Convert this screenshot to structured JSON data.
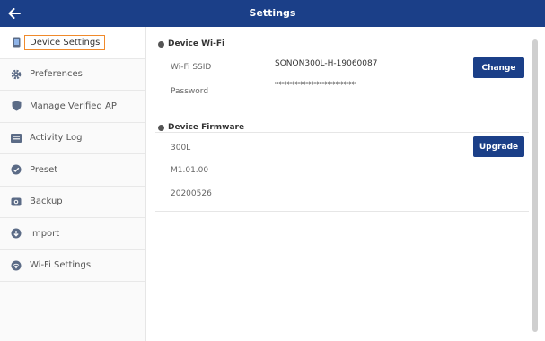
{
  "header": {
    "title": "Settings",
    "back_icon": "arrow-left-icon"
  },
  "sidebar": {
    "items": [
      {
        "label": "Device Settings",
        "icon": "phone-icon",
        "active": true
      },
      {
        "label": "Preferences",
        "icon": "gear-icon"
      },
      {
        "label": "Manage Verified AP",
        "icon": "shield-icon"
      },
      {
        "label": "Activity Log",
        "icon": "log-icon"
      },
      {
        "label": "Preset",
        "icon": "check-circle-icon"
      },
      {
        "label": "Backup",
        "icon": "backup-icon"
      },
      {
        "label": "Import",
        "icon": "import-icon"
      },
      {
        "label": "Wi-Fi Settings",
        "icon": "wifi-icon"
      }
    ]
  },
  "wifi": {
    "heading": "Device Wi-Fi",
    "ssid_label": "Wi-Fi SSID",
    "ssid_value": "SONON300L-H-19060087",
    "password_label": "Password",
    "password_value": "********************",
    "button": "Change"
  },
  "firmware": {
    "heading": "Device Firmware",
    "lines": [
      "300L",
      "M1.01.00",
      "20200526"
    ],
    "button": "Upgrade"
  },
  "colors": {
    "header": "#1b3f88",
    "button": "#1b3f88",
    "active_border": "#f08a2b",
    "icon": "#5b6b86"
  }
}
